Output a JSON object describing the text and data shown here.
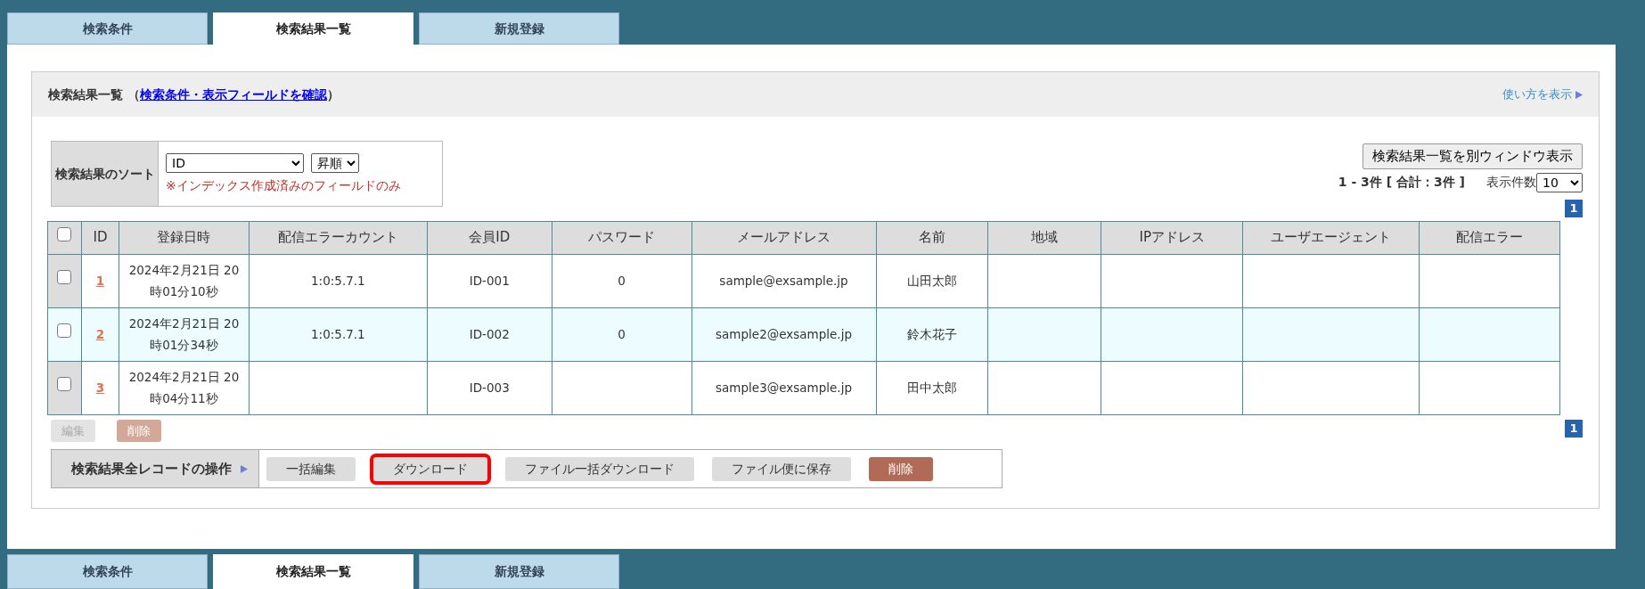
{
  "tabs_top": [
    {
      "label": "検索条件",
      "selected": false
    },
    {
      "label": "検索結果一覧",
      "selected": true
    },
    {
      "label": "新規登録",
      "selected": false
    }
  ],
  "panel": {
    "title": "検索結果一覧",
    "open_paren": "（",
    "link": "検索条件・表示フィールドを確認",
    "close_paren": "）",
    "help_link": "使い方を表示"
  },
  "sort": {
    "label": "検索結果のソート",
    "field": "ID",
    "order": "昇順",
    "note": "※インデックス作成済みのフィールドのみ"
  },
  "open_window_button": "検索結果一覧を別ウィンドウ表示",
  "summary": "1 - 3件 [ 合計：3件 ]",
  "per_page_label": "表示件数",
  "per_page": "10",
  "pager_top": [
    {
      "label": "1",
      "selected": true
    }
  ],
  "table": {
    "select_all_checked": false,
    "columns": [
      "ID",
      "登録日時",
      "配信エラーカウント",
      "会員ID",
      "パスワード",
      "メールアドレス",
      "名前",
      "地域",
      "IPアドレス",
      "ユーザエージェント",
      "配信エラー"
    ],
    "rows": [
      {
        "checked": false,
        "highlighted": false,
        "cells": [
          "1",
          "2024年2月21日 20時01分10秒",
          "1:0:5.7.1",
          "ID-001",
          "0",
          "sample@exsample.jp",
          "山田太郎",
          "",
          "",
          "",
          ""
        ]
      },
      {
        "checked": false,
        "highlighted": true,
        "cells": [
          "2",
          "2024年2月21日 20時01分34秒",
          "1:0:5.7.1",
          "ID-002",
          "0",
          "sample2@exsample.jp",
          "鈴木花子",
          "",
          "",
          "",
          ""
        ]
      },
      {
        "checked": false,
        "highlighted": false,
        "cells": [
          "3",
          "2024年2月21日 20時04分11秒",
          "",
          "ID-003",
          "",
          "sample3@exsample.jp",
          "田中太郎",
          "",
          "",
          "",
          ""
        ]
      }
    ]
  },
  "row_actions": [
    {
      "label": "編集",
      "kind": "edit",
      "disabled": true
    },
    {
      "label": "削除",
      "kind": "delete",
      "disabled": true
    }
  ],
  "pager_bottom": [
    {
      "label": "1",
      "selected": true
    }
  ],
  "bulk": {
    "label": "検索結果全レコードの操作",
    "buttons": [
      {
        "label": "一括編集",
        "kind": "normal",
        "highlighted": false
      },
      {
        "label": "ダウンロード",
        "kind": "normal",
        "highlighted": true
      },
      {
        "label": "ファイル一括ダウンロード",
        "kind": "normal",
        "highlighted": false
      },
      {
        "label": "ファイル便に保存",
        "kind": "normal",
        "highlighted": false
      },
      {
        "label": "削除",
        "kind": "danger",
        "highlighted": false
      }
    ]
  },
  "tabs_bottom": [
    {
      "label": "検索条件",
      "selected": false
    },
    {
      "label": "検索結果一覧",
      "selected": true
    },
    {
      "label": "新規登録",
      "selected": false
    }
  ]
}
